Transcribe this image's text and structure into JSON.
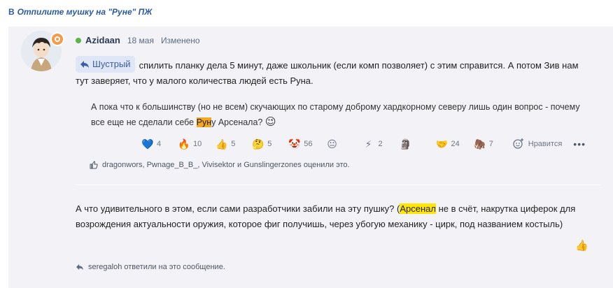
{
  "breadcrumb": {
    "prefix": "В",
    "topic": "Отпилите мушку на \"Руне\" ПЖ"
  },
  "post": {
    "author": "Azidaan",
    "date": "18 мая",
    "edited": "Изменено",
    "mention": "Шустрый",
    "text_line": "спилить планку дела 5 минут, даже школьник (если комп позволяет) с этим справится. А потом Зив нам тут заверяет, что у малого количества людей есть Руна.",
    "quote_before": "А пока что к большинству (но не всем) скучающих по старому доброму хардкорному северу лишь один вопрос - почему все еще не сделали себе ",
    "quote_highlight": "Рун",
    "quote_after": "у Арсенала?",
    "quote_emoji": "😉",
    "reactions": [
      {
        "emoji": "💙",
        "name": "heart-reaction",
        "count": "4"
      },
      {
        "emoji": "🔥",
        "name": "fire-reaction",
        "count": "10"
      },
      {
        "emoji": "👍",
        "name": "thumbs-up-reaction",
        "count": "5"
      },
      {
        "emoji": "🤔",
        "name": "thinking-reaction",
        "count": "5"
      },
      {
        "emoji": "🤡",
        "name": "clown-reaction",
        "count": "56"
      },
      {
        "emoji": "😐",
        "name": "neutral-face-reaction",
        "count": ""
      },
      {
        "emoji": "⚡",
        "name": "lightning-reaction",
        "count": "2"
      },
      {
        "emoji": "🗿",
        "name": "moai-reaction",
        "count": ""
      },
      {
        "emoji": "🤝",
        "name": "handshake-reaction",
        "count": "24"
      },
      {
        "emoji": "🦣",
        "name": "mammoth-reaction",
        "count": "7"
      }
    ],
    "like_label": "Нравится",
    "more_label": "•••",
    "likers_text": "dragonwors, Pwnage_B_B_, Vivisektor и Gunslingerzones оценили это."
  },
  "reply": {
    "before": "А что удивительного в этом, если сами разработчики забили на эту пушку? (",
    "highlight": "Арсенал",
    "after": " не в счёт, накрутка циферок для возрождения актуальности оружия, которое фиг получишь, через убогую механику - цирк, под названием костыль)",
    "thumb_emoji": "👍",
    "replied_text": "seregaloh ответили на это сообщение."
  },
  "colors": {
    "accent": "#2b5aa6",
    "online": "#5bb54a",
    "highlight_orange": "#f5a623",
    "highlight_yellow": "#ffe600",
    "card_bg": "#f3f3f7"
  }
}
